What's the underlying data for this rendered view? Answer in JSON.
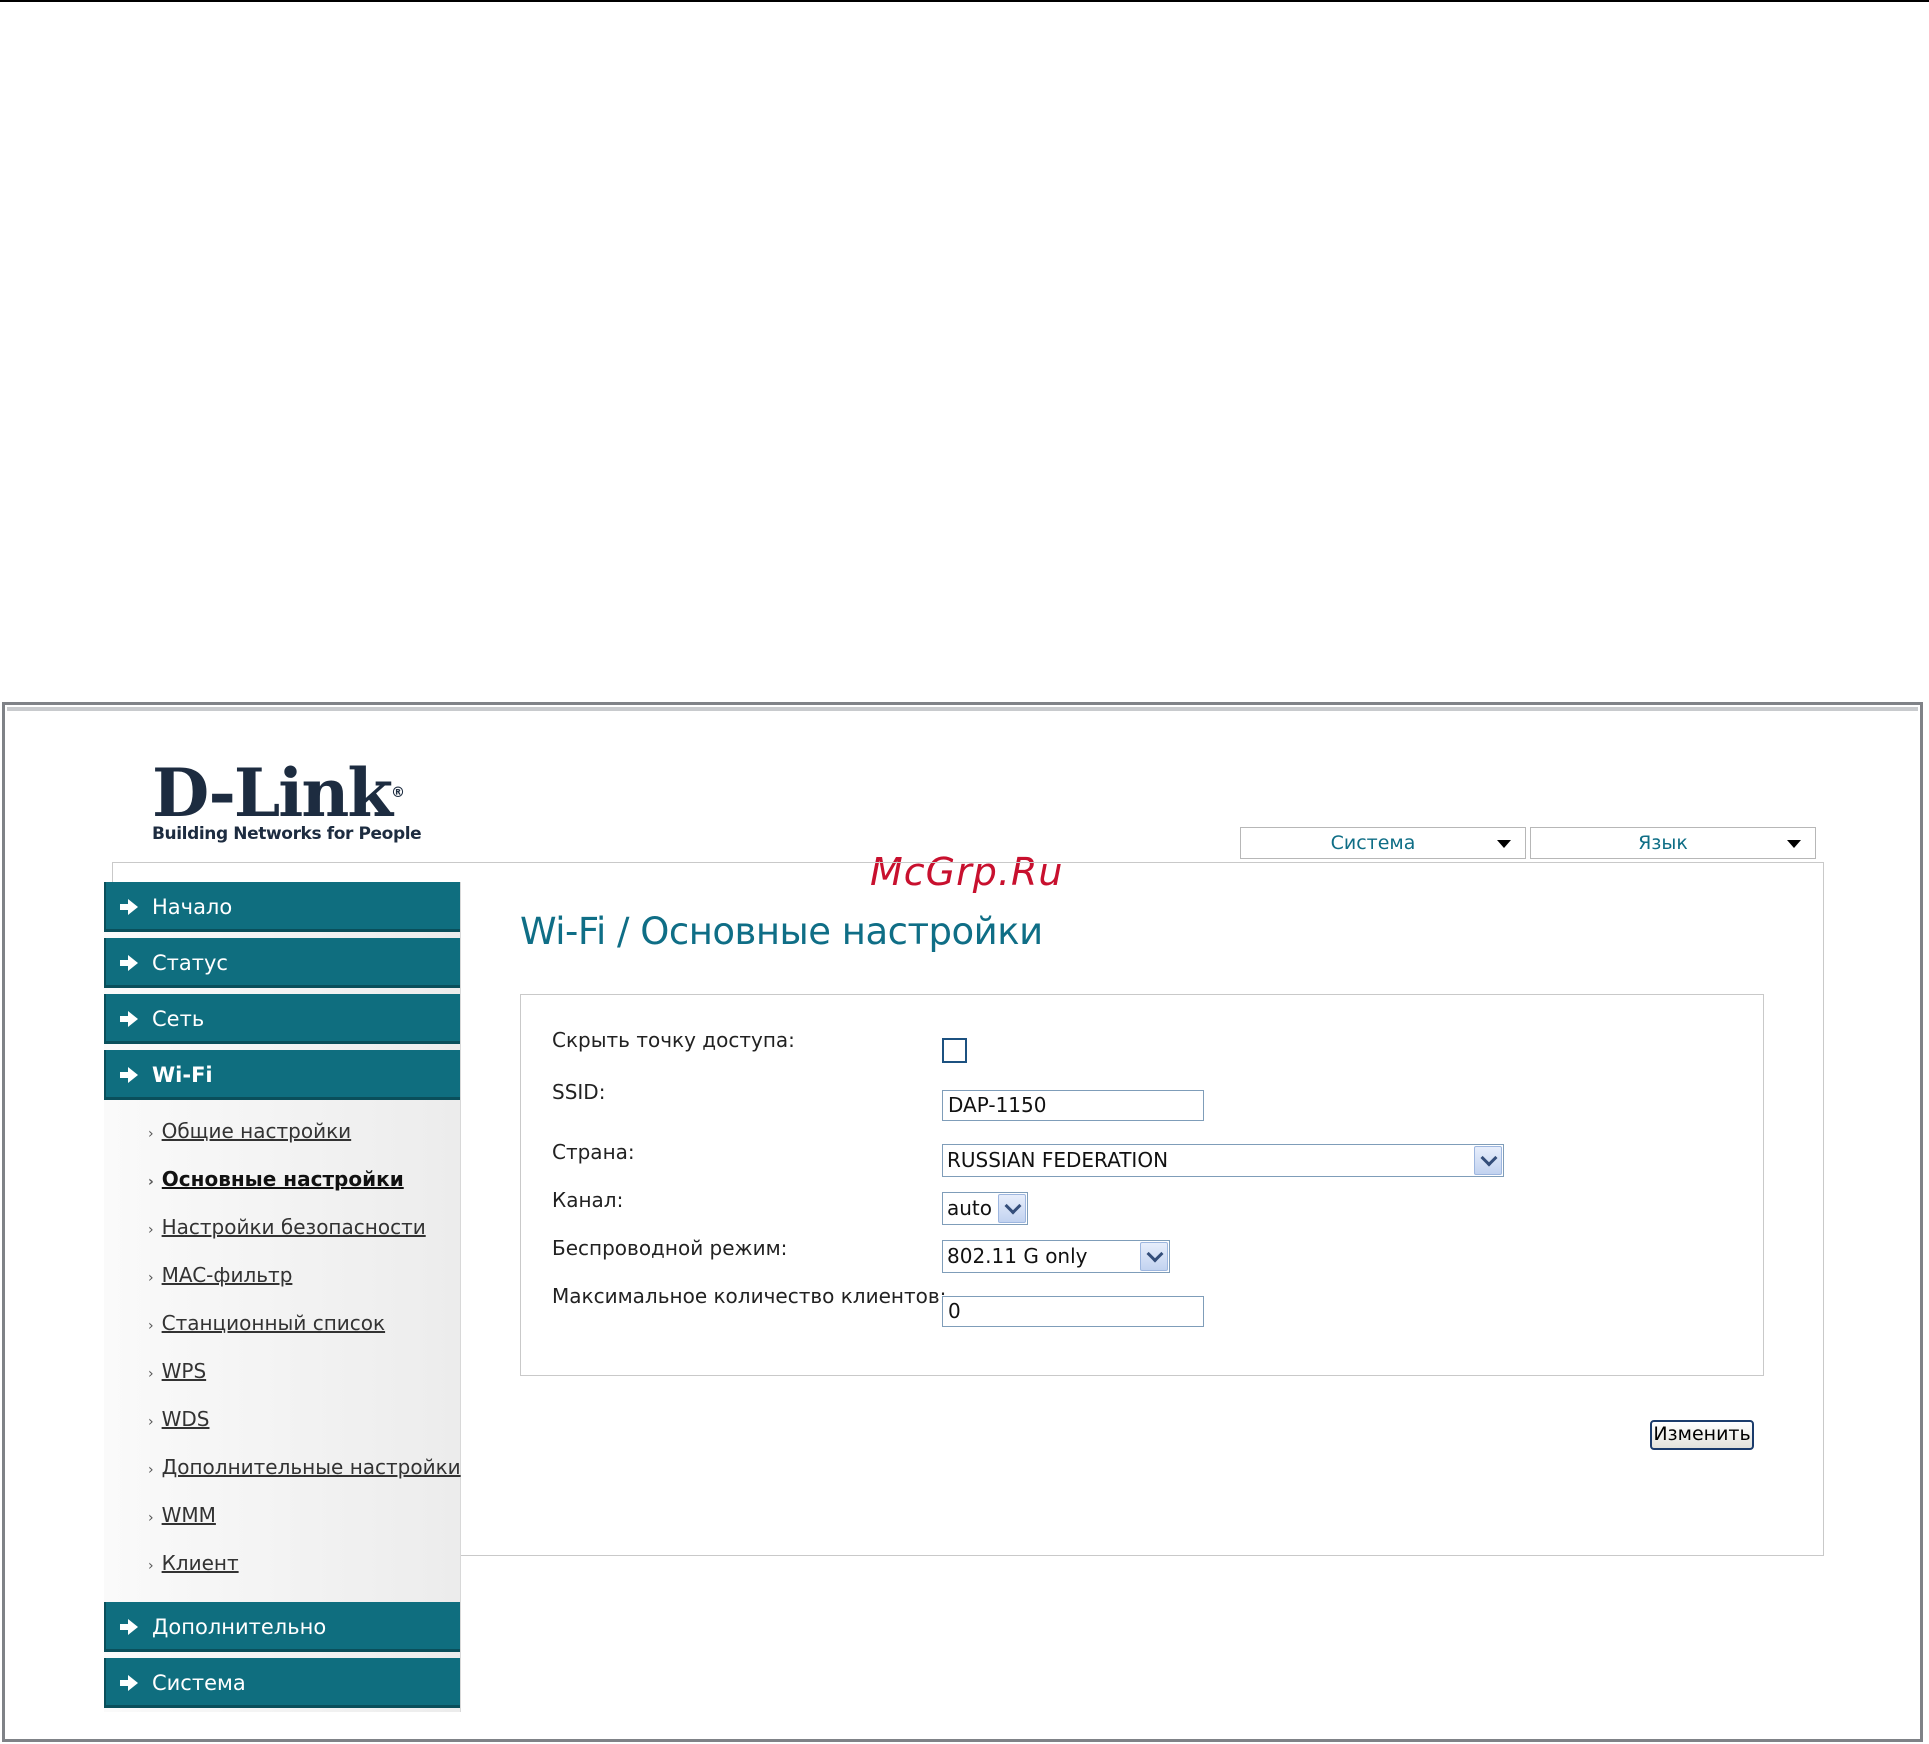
{
  "logo": {
    "brand": "D-Link",
    "tagline": "Building Networks for People"
  },
  "topbar": {
    "system_label": "Система",
    "language_label": "Язык"
  },
  "watermark": "McGrp.Ru",
  "sidebar": {
    "items": [
      {
        "label": "Начало"
      },
      {
        "label": "Статус"
      },
      {
        "label": "Сеть"
      },
      {
        "label": "Wi-Fi"
      },
      {
        "label": "Дополнительно"
      },
      {
        "label": "Система"
      }
    ],
    "wifi_subitems": [
      {
        "label": "Общие настройки"
      },
      {
        "label": "Основные настройки"
      },
      {
        "label": "Настройки безопасности"
      },
      {
        "label": "MAC-фильтр"
      },
      {
        "label": "Станционный список"
      },
      {
        "label": "WPS"
      },
      {
        "label": "WDS"
      },
      {
        "label": "Дополнительные настройки"
      },
      {
        "label": "WMM"
      },
      {
        "label": "Клиент"
      }
    ]
  },
  "main": {
    "title": "Wi-Fi /  Основные настройки",
    "form": {
      "hide_ap_label": "Скрыть точку доступа:",
      "ssid_label": "SSID:",
      "ssid_value": "DAP-1150",
      "country_label": "Страна:",
      "country_value": "RUSSIAN FEDERATION",
      "channel_label": "Канал:",
      "channel_value": "auto",
      "mode_label": "Беспроводной режим:",
      "mode_value": "802.11 G only",
      "max_clients_label": "Максимальное количество клиентов:",
      "max_clients_value": "0"
    },
    "apply_label": "Изменить"
  },
  "colors": {
    "accent": "#0f6e7f",
    "title": "#0f6e86",
    "watermark": "#c8102e"
  }
}
